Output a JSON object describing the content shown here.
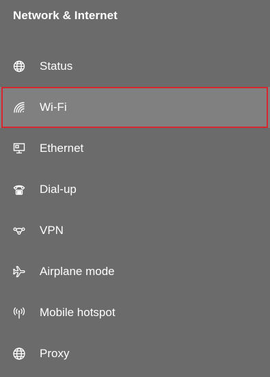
{
  "header": {
    "title": "Network & Internet"
  },
  "colors": {
    "background": "#6b6b6b",
    "selected_background": "#808080",
    "highlight_border": "#d6262e",
    "text": "#ffffff"
  },
  "nav": {
    "items": [
      {
        "label": "Status",
        "icon": "globe-icon",
        "selected": false
      },
      {
        "label": "Wi-Fi",
        "icon": "wifi-icon",
        "selected": true
      },
      {
        "label": "Ethernet",
        "icon": "ethernet-icon",
        "selected": false
      },
      {
        "label": "Dial-up",
        "icon": "dialup-phone-icon",
        "selected": false
      },
      {
        "label": "VPN",
        "icon": "vpn-icon",
        "selected": false
      },
      {
        "label": "Airplane mode",
        "icon": "airplane-icon",
        "selected": false
      },
      {
        "label": "Mobile hotspot",
        "icon": "hotspot-icon",
        "selected": false
      },
      {
        "label": "Proxy",
        "icon": "globe-icon",
        "selected": false
      }
    ]
  }
}
